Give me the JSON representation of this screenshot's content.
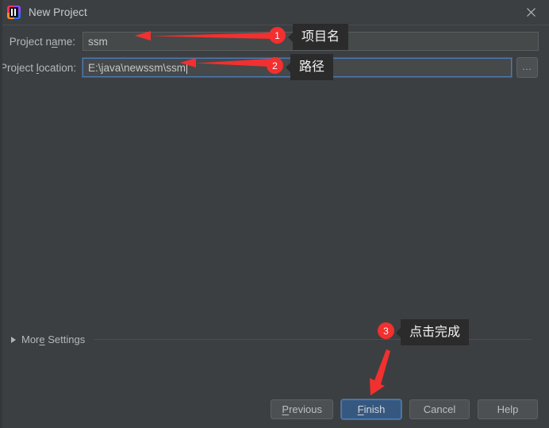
{
  "window": {
    "title": "New Project",
    "app_icon": "intellij-idea-icon",
    "close_icon": "close-icon"
  },
  "form": {
    "name_label_pre": "Project n",
    "name_label_mnemonic": "a",
    "name_label_post": "me:",
    "name_value": "ssm",
    "name_placeholder": "",
    "location_label_pre": "Project ",
    "location_label_mnemonic": "l",
    "location_label_post": "ocation:",
    "location_value": "E:\\java\\newssm\\ssm",
    "location_placeholder": "",
    "browse_label": "...",
    "browse_icon": "ellipsis-icon"
  },
  "more_settings": {
    "label_pre": "Mor",
    "label_mnemonic": "e",
    "label_post": " Settings",
    "expander_icon": "triangle-right-icon",
    "expanded": "false"
  },
  "buttons": {
    "previous_pre": "",
    "previous_mnemonic": "P",
    "previous_post": "revious",
    "finish_pre": "",
    "finish_mnemonic": "F",
    "finish_post": "inish",
    "cancel": "Cancel",
    "help": "Help"
  },
  "annotations": [
    {
      "number": "1",
      "text": "项目名"
    },
    {
      "number": "2",
      "text": "路径"
    },
    {
      "number": "3",
      "text": "点击完成"
    }
  ],
  "colors": {
    "background": "#3c3f41",
    "accent_blue": "#365880",
    "annotation_red": "#f2302f",
    "tooltip_bg": "#2b2b2c",
    "field_bg": "#45494a"
  }
}
